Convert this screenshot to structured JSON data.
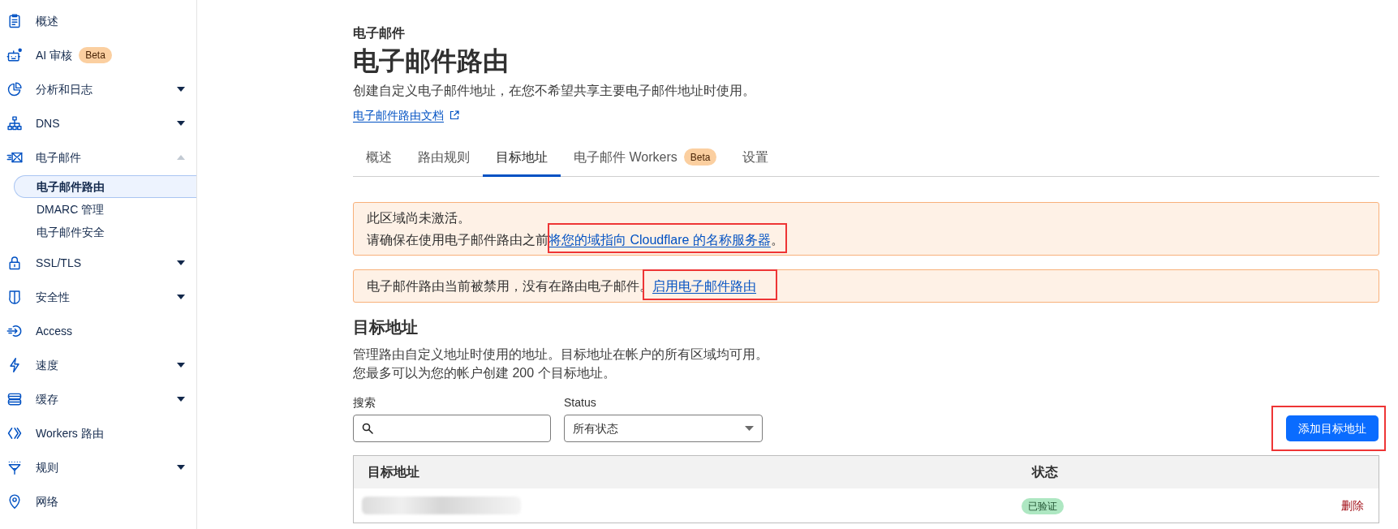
{
  "sidebar": {
    "items": [
      {
        "label": "概述"
      },
      {
        "label": "AI 审核",
        "badge": "Beta"
      },
      {
        "label": "分析和日志",
        "expanded": false
      },
      {
        "label": "DNS",
        "expanded": false
      },
      {
        "label": "电子邮件",
        "expanded": true,
        "children": [
          {
            "label": "电子邮件路由",
            "selected": true
          },
          {
            "label": "DMARC 管理",
            "selected": false
          },
          {
            "label": "电子邮件安全",
            "selected": false
          }
        ]
      },
      {
        "label": "SSL/TLS",
        "expanded": false
      },
      {
        "label": "安全性",
        "expanded": false
      },
      {
        "label": "Access"
      },
      {
        "label": "速度",
        "expanded": false
      },
      {
        "label": "缓存",
        "expanded": false
      },
      {
        "label": "Workers 路由"
      },
      {
        "label": "规则",
        "expanded": false
      },
      {
        "label": "网络"
      }
    ]
  },
  "header": {
    "section": "电子邮件",
    "title": "电子邮件路由",
    "description": "创建自定义电子邮件地址，在您不希望共享主要电子邮件地址时使用。",
    "doc_link": "电子邮件路由文档"
  },
  "tabs": [
    {
      "label": "概述",
      "selected": false
    },
    {
      "label": "路由规则",
      "selected": false
    },
    {
      "label": "目标地址",
      "selected": true
    },
    {
      "label": "电子邮件 Workers",
      "badge": "Beta",
      "selected": false
    },
    {
      "label": "设置",
      "selected": false
    }
  ],
  "alerts": [
    {
      "lines": [
        {
          "parts": [
            {
              "kind": "text",
              "text": "此区域尚未激活。"
            }
          ]
        },
        {
          "parts": [
            {
              "kind": "text",
              "text": "请确保在使用电子邮件路由之前"
            },
            {
              "kind": "link",
              "text": "将您的域指向 Cloudflare 的名称服务器",
              "highlighted": true
            },
            {
              "kind": "text",
              "text": "。"
            }
          ]
        }
      ]
    },
    {
      "lines": [
        {
          "parts": [
            {
              "kind": "text",
              "text": "电子邮件路由当前被禁用，没有在路由电子邮件。"
            },
            {
              "kind": "link",
              "text": "启用电子邮件路由",
              "highlighted": true
            }
          ]
        }
      ]
    }
  ],
  "section": {
    "title": "目标地址",
    "description": [
      "管理路由自定义地址时使用的地址。目标地址在帐户的所有区域均可用。",
      "您最多可以为您的帐户创建 200 个目标地址。"
    ]
  },
  "filters": {
    "search": {
      "label": "搜索"
    },
    "status": {
      "label": "Status",
      "value": "所有状态"
    }
  },
  "add_button": {
    "label": "添加目标地址",
    "highlighted": true
  },
  "table": {
    "columns": [
      "目标地址",
      "状态"
    ],
    "rows": [
      {
        "address_redacted": true,
        "status": "已验证",
        "action": "删除"
      }
    ]
  }
}
